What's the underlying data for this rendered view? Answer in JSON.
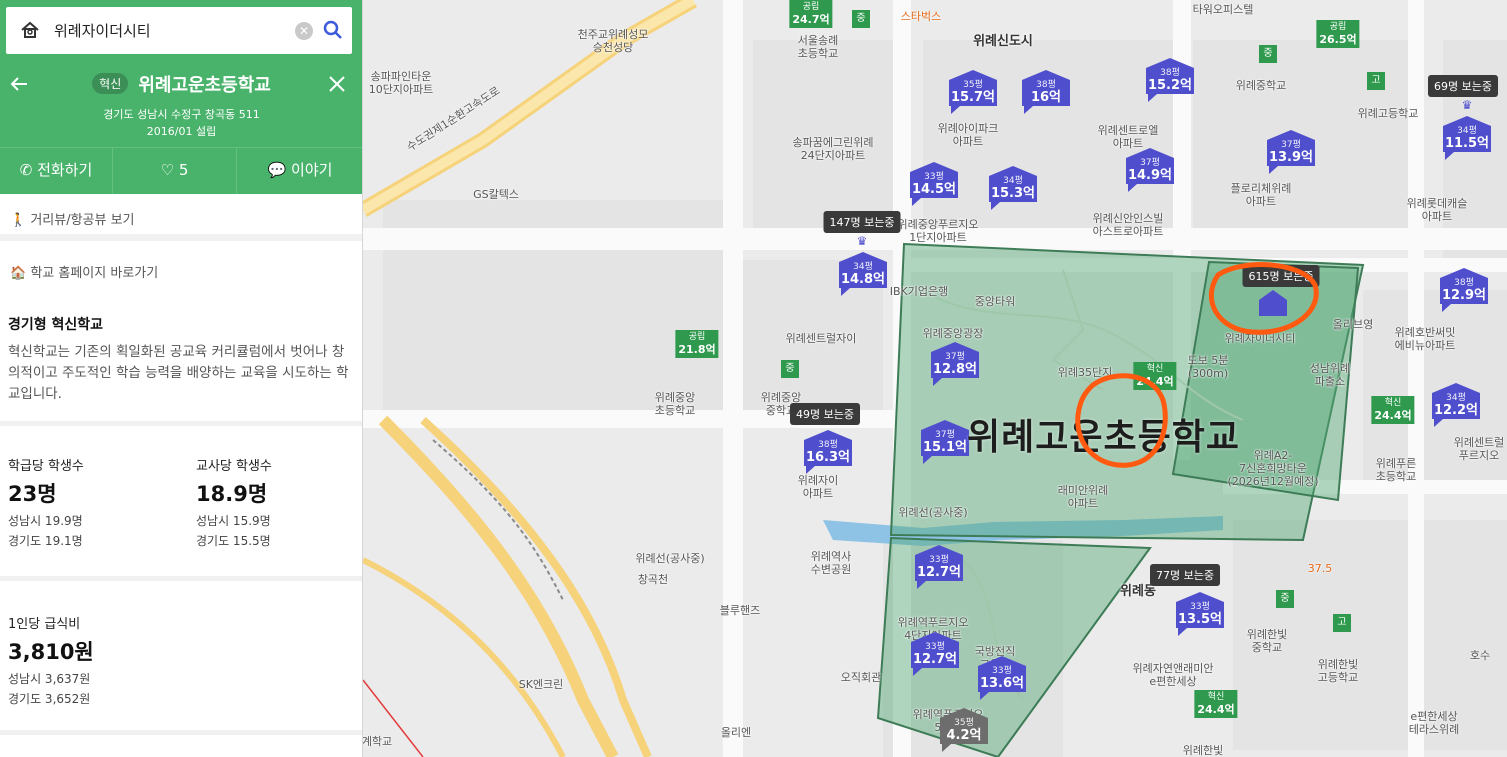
{
  "search": {
    "query": "위례자이더시티"
  },
  "school": {
    "badge": "혁신",
    "name": "위례고운초등학교",
    "address": "경기도 성남시 수정구 창곡동 511",
    "established": "2016/01 설립"
  },
  "actions": {
    "call": "전화하기",
    "likes": "5",
    "talk": "이야기"
  },
  "links": {
    "streetview": "거리뷰/항공뷰 보기",
    "homepage": "학교 홈페이지 바로가기"
  },
  "innovation": {
    "title": "경기형 혁신학교",
    "description": "혁신학교는 기존의 획일화된 공교육 커리큘럼에서 벗어나 창의적이고 주도적인 학습 능력을 배양하는 교육을 시도하는 학교입니다."
  },
  "stats": {
    "students_per_class": {
      "label": "학급당 학생수",
      "value": "23명",
      "seongnam": "성남시 19.9명",
      "gyeonggi": "경기도 19.1명"
    },
    "students_per_teacher": {
      "label": "교사당 학생수",
      "value": "18.9명",
      "seongnam": "성남시 15.9명",
      "gyeonggi": "경기도 15.5명"
    },
    "meal_cost": {
      "label": "1인당 급식비",
      "value": "3,810원",
      "seongnam": "성남시 3,637원",
      "gyeonggi": "경기도 3,652원"
    }
  },
  "map": {
    "main_label": "위례고운초등학교",
    "apartments": [
      {
        "py": "35평",
        "price": "15.7억"
      },
      {
        "py": "38평",
        "price": "16억"
      },
      {
        "py": "38평",
        "price": "15.2억"
      },
      {
        "py": "37평",
        "price": "13.9억"
      },
      {
        "py": "34평",
        "price": "11.5억"
      },
      {
        "py": "33평",
        "price": "14.5억"
      },
      {
        "py": "34평",
        "price": "15.3억"
      },
      {
        "py": "37평",
        "price": "14.9억"
      },
      {
        "py": "34평",
        "price": "14.8억"
      },
      {
        "py": "38평",
        "price": "12.9억"
      },
      {
        "py": "37평",
        "price": "12.8억"
      },
      {
        "py": "37평",
        "price": "15.1억"
      },
      {
        "py": "38평",
        "price": "16.3억"
      },
      {
        "py": "34평",
        "price": "12.2억"
      },
      {
        "py": "33평",
        "price": "12.7억"
      },
      {
        "py": "33평",
        "price": "13.5억"
      },
      {
        "py": "33평",
        "price": "12.7억"
      },
      {
        "py": "33평",
        "price": "13.6억"
      },
      {
        "py": "35평",
        "price": "4.2억"
      }
    ],
    "schools": [
      {
        "type": "공립",
        "score": "24.7억"
      },
      {
        "type": "공립",
        "score": "26.5억"
      },
      {
        "type": "공립",
        "score": "21.8억"
      },
      {
        "type": "혁신",
        "score": "24.4억"
      },
      {
        "type": "혁신",
        "score": "24.4억"
      },
      {
        "type": "혁신",
        "score": "24.4억"
      }
    ],
    "viewers": [
      "69명 보는중",
      "147명 보는중",
      "615명 보는중",
      "49명 보는중",
      "77명 보는중"
    ],
    "labels": {
      "l1": "천주교위례성모\n승천성당",
      "l2": "스타벅스",
      "l3": "위례신도시",
      "l4": "송파파인타운\n10단지아파트",
      "l5": "서울송례\n초등학교",
      "l6": "송파꿈에그린위례\n24단지아파트",
      "l7": "위례아이파크\n아파트",
      "l8": "위례센트로엘\n아파트",
      "l9": "위례중학교",
      "l10": "위례고등학교",
      "l11": "플로리체위례\n아파트",
      "l12": "위례롯데캐슬\n아파트",
      "l13": "위례신안인스빌\n아스트로아파트",
      "l14": "위례중앙푸르지오\n1단지아파트",
      "l15": "GS칼텍스",
      "l16": "수도권제1순환고속도로",
      "l17": "IBK기업은행",
      "l18": "중앙타워",
      "l19": "위례중앙광장",
      "l20": "위례센트럴자이",
      "l21": "위례자이더시티",
      "l22": "올리브영",
      "l23": "위례호반써밋\n에비뉴아파트",
      "l24": "성남위례\n파출소",
      "l25": "도보 5분\n(300m)",
      "l26": "위례중앙\n초등학교",
      "l27": "위례중앙\n중학교",
      "l28": "위례자이\n아파트",
      "l29": "위례A2-\n7신혼희망타운\n(2026년12월예정)",
      "l30": "래미안위례\n아파트",
      "l31": "위례푸른\n초등학교",
      "l32": "위례센트럴\n푸르지오",
      "l33": "위례선(공사중)",
      "l34": "위례역사\n수변공원",
      "l35": "창곡천",
      "l36": "블루핸즈",
      "l37": "위례동",
      "l38": "위례한빛\n중학교",
      "l39": "위례한빛\n고등학교",
      "l40": "위례자연앤래미안\ne편한세상",
      "l41": "e편한세상\n테라스위례",
      "l42": "위례역푸르지오\n4단지아파트",
      "l43": "국방전직\n교육원",
      "l44": "SK엔크린",
      "l45": "오직회관",
      "l46": "올리엔",
      "l47": "위례한빛",
      "l48": "호수",
      "l49": "타워오피스텔",
      "l50": "37.5",
      "l51": "위례35단지",
      "l52": "위례역푸르지오\n5단지",
      "l53": "계학교"
    }
  },
  "colors": {
    "brand_green": "#49b36b",
    "apt_marker": "#4f4fce",
    "school_green": "#2f9a4e",
    "zone_fill": "rgba(84,168,118,0.45)",
    "annotation": "#ff5a10"
  }
}
